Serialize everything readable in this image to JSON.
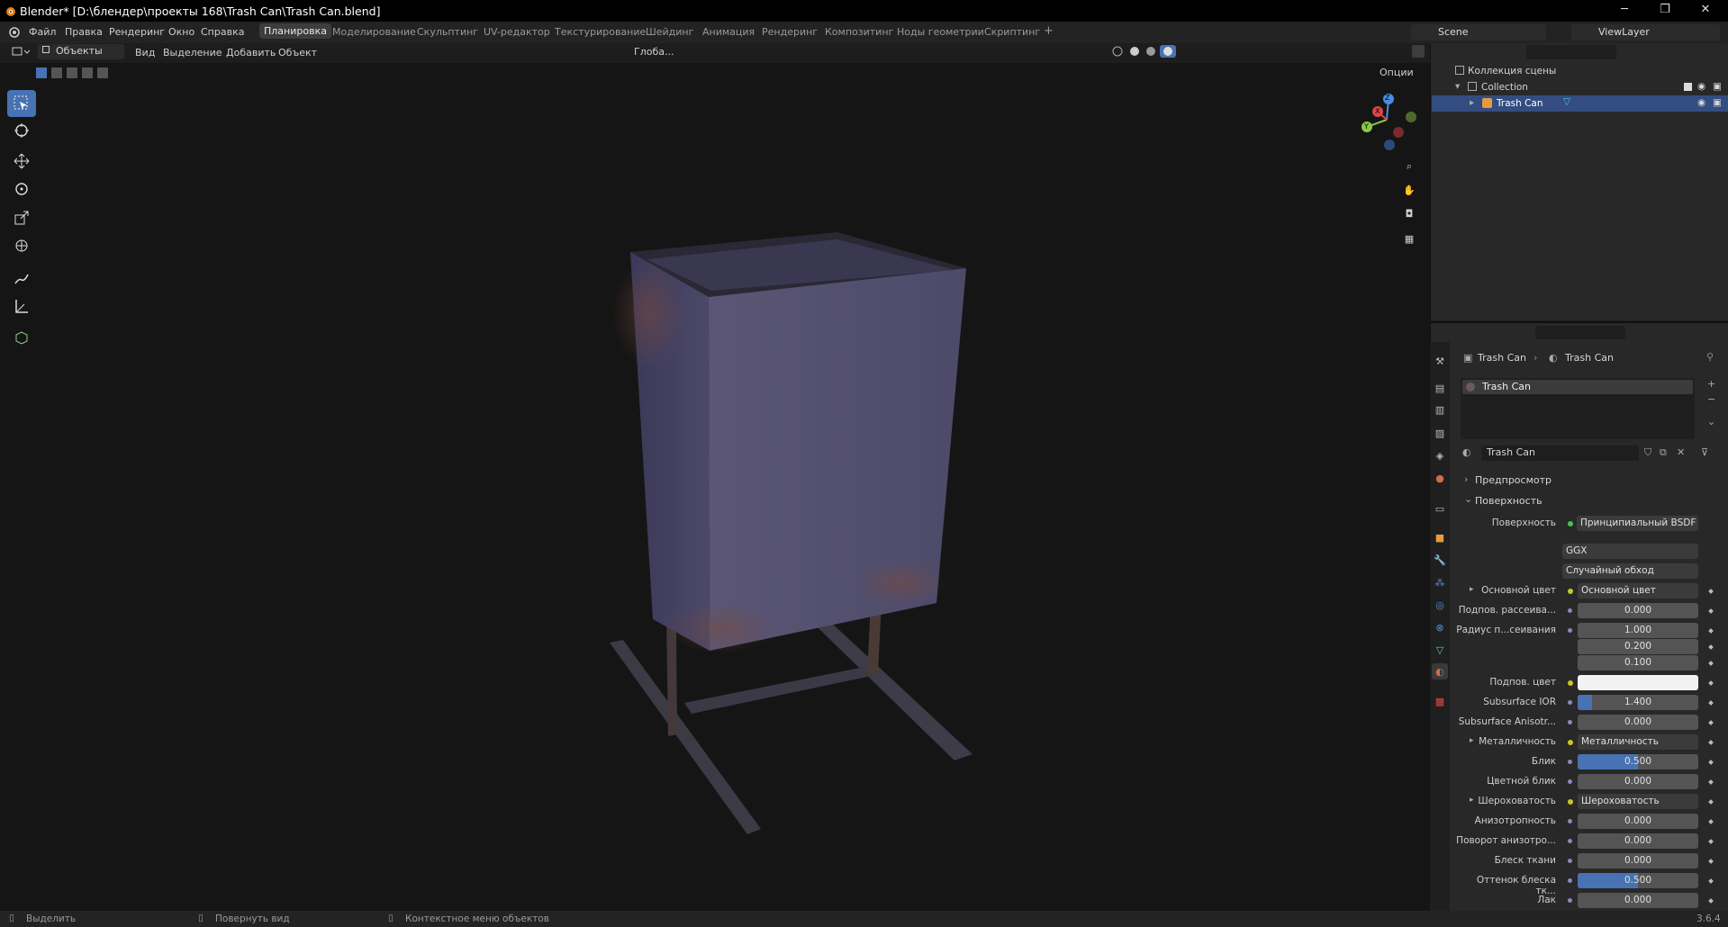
{
  "window": {
    "title": "Blender* [D:\\блендер\\проекты 168\\Trash Can\\Trash Can.blend]",
    "minimize": "─",
    "maximize": "❐",
    "close": "✕"
  },
  "menu": [
    "Файл",
    "Правка",
    "Рендеринг",
    "Окно",
    "Справка"
  ],
  "workspaces": [
    "Планировка",
    "Моделирование",
    "Скульптинг",
    "UV-редактор",
    "Текстурирование",
    "Шейдинг",
    "Анимация",
    "Рендеринг",
    "Композитинг",
    "Ноды геометрии",
    "Скриптинг"
  ],
  "workspace_add": "+",
  "scene": {
    "name": "Scene",
    "view_layer": "ViewLayer"
  },
  "viewport_header": {
    "mode": "Объекты",
    "menus": [
      "Вид",
      "Выделение",
      "Добавить",
      "Объект"
    ],
    "transform_orientation": "Глоба...",
    "options": "Опции"
  },
  "gizmo": {
    "z": "Z",
    "y": "Y",
    "x": "X"
  },
  "outliner": {
    "scene_collection": "Коллекция сцены",
    "collection": "Collection",
    "object": "Trash Can"
  },
  "properties": {
    "breadcrumb_object": "Trash Can",
    "breadcrumb_material": "Trash Can",
    "slot": "Trash Can",
    "material_name": "Trash Can",
    "panel_preview": "Предпросмотр",
    "panel_surface": "Поверхность",
    "surface_label": "Поверхность",
    "surface_value": "Принципиальный BSDF",
    "distribution": "GGX",
    "subsurface_method": "Случайный обход",
    "rows": [
      {
        "label": "Основной цвет",
        "value": "Основной цвет",
        "type": "link",
        "expand": true
      },
      {
        "label": "Подпов. рассеива...",
        "value": "0.000",
        "type": "num",
        "fill": 0
      },
      {
        "label": "Радиус п...сеивания",
        "value": "1.000",
        "type": "num",
        "fill": 0
      },
      {
        "label": "",
        "value": "0.200",
        "type": "num",
        "fill": 0
      },
      {
        "label": "",
        "value": "0.100",
        "type": "num",
        "fill": 0
      },
      {
        "label": "Подпов. цвет",
        "value": "",
        "type": "color",
        "fill": 0
      },
      {
        "label": "Subsurface IOR",
        "value": "1.400",
        "type": "num",
        "fill": 0.12
      },
      {
        "label": "Subsurface Anisotr...",
        "value": "0.000",
        "type": "num",
        "fill": 0
      },
      {
        "label": "Металличность",
        "value": "Металличность",
        "type": "link",
        "expand": true
      },
      {
        "label": "Блик",
        "value": "0.500",
        "type": "num",
        "fill": 0.5
      },
      {
        "label": "Цветной блик",
        "value": "0.000",
        "type": "num",
        "fill": 0
      },
      {
        "label": "Шероховатость",
        "value": "Шероховатость",
        "type": "link",
        "expand": true
      },
      {
        "label": "Анизотропность",
        "value": "0.000",
        "type": "num",
        "fill": 0
      },
      {
        "label": "Поворот анизотро...",
        "value": "0.000",
        "type": "num",
        "fill": 0
      },
      {
        "label": "Блеск ткани",
        "value": "0.000",
        "type": "num",
        "fill": 0
      },
      {
        "label": "Оттенок блеска тк...",
        "value": "0.500",
        "type": "num",
        "fill": 0.5
      },
      {
        "label": "Лак",
        "value": "0.000",
        "type": "num",
        "fill": 0
      }
    ]
  },
  "status": {
    "left": "Выделить",
    "middle": "Повернуть вид",
    "right": "Контекстное меню объектов",
    "version": "3.6.4"
  },
  "colors": {
    "accent": "#4772b3",
    "selected_row": "#334d80",
    "socket_yellow": "#c7c729",
    "socket_gray": "#6363c7"
  }
}
